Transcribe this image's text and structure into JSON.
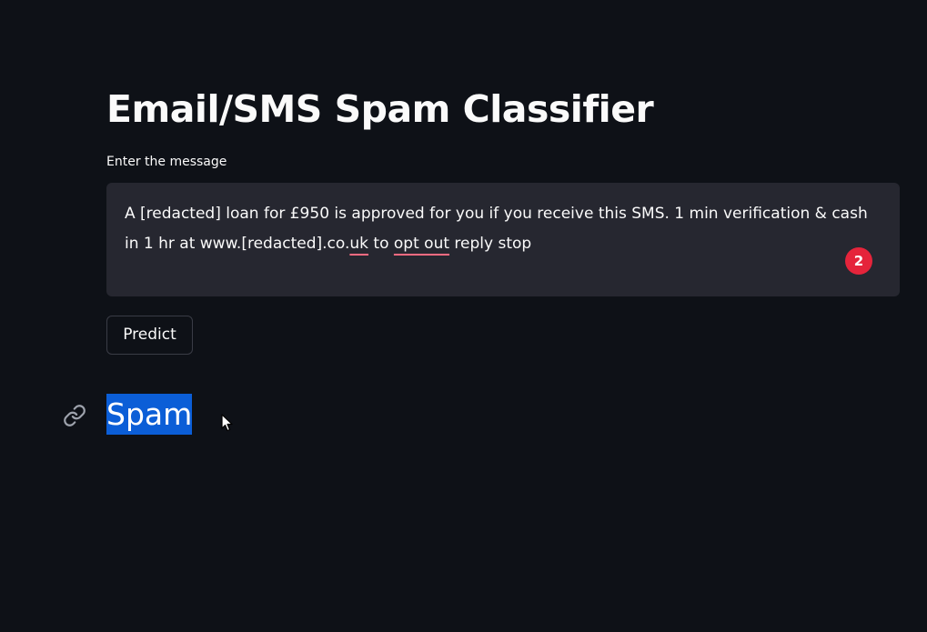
{
  "app": {
    "title": "Email/SMS Spam Classifier"
  },
  "form": {
    "label": "Enter the message",
    "message_parts": [
      "A [redacted] loan for £950 is approved for you if you receive this SMS. 1 min verification & cash in 1 hr at www.[redacted].co.",
      "uk",
      " to ",
      "opt out",
      " reply stop"
    ],
    "grammar_badge_count": "2",
    "predict_label": "Predict"
  },
  "result": {
    "label": "Spam",
    "link_icon": "link-icon"
  },
  "colors": {
    "background": "#0e1117",
    "input_background": "#262730",
    "selection_highlight": "#0b5ed7",
    "badge": "#e5243b",
    "spellcheck_underline": "#ff6b81"
  }
}
